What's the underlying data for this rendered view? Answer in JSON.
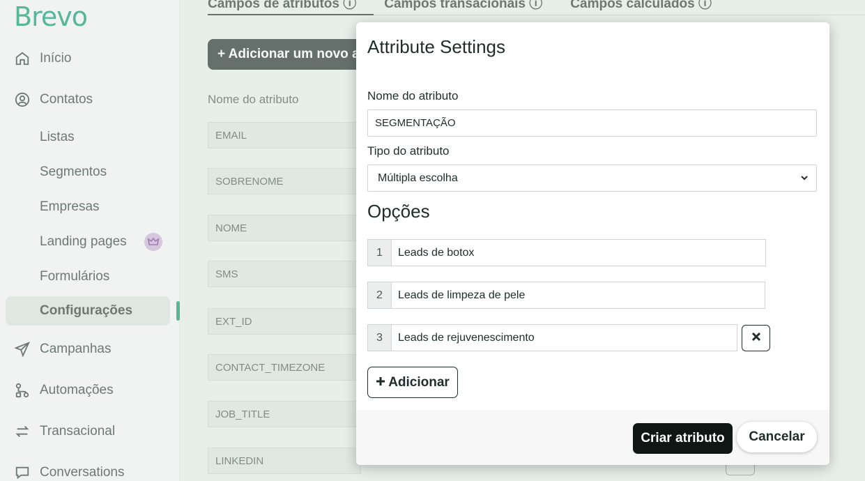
{
  "app": {
    "logo": "Brevo"
  },
  "sidebar": {
    "items": [
      {
        "label": "Início",
        "icon": "home-icon"
      },
      {
        "label": "Contatos",
        "icon": "contacts-icon"
      },
      {
        "label": "Campanhas",
        "icon": "send-icon"
      },
      {
        "label": "Automações",
        "icon": "automation-icon"
      },
      {
        "label": "Transacional",
        "icon": "transactional-icon"
      },
      {
        "label": "Conversations",
        "icon": "chat-icon"
      }
    ],
    "subitems": [
      {
        "label": "Listas"
      },
      {
        "label": "Segmentos"
      },
      {
        "label": "Empresas"
      },
      {
        "label": "Landing pages",
        "badge": "crown-icon"
      },
      {
        "label": "Formulários"
      },
      {
        "label": "Configurações",
        "active": true
      }
    ]
  },
  "main": {
    "tabs": [
      {
        "label": "Campos de atributos ⓘ"
      },
      {
        "label": "Campos transacionais ⓘ"
      },
      {
        "label": "Campos calculados ⓘ"
      }
    ],
    "add_button": "+ Adicionar um novo atributo",
    "column_header": "Nome do atributo",
    "attributes": [
      "EMAIL",
      "SOBRENOME",
      "NOME",
      "SMS",
      "EXT_ID",
      "CONTACT_TIMEZONE",
      "JOB_TITLE",
      "LINKEDIN"
    ]
  },
  "modal": {
    "title": "Attribute Settings",
    "name_label": "Nome do atributo",
    "name_value": "SEGMENTAÇÃO",
    "type_label": "Tipo do atributo",
    "type_value": "Múltipla escolha",
    "options_title": "Opções",
    "options": [
      {
        "num": "1",
        "value": "Leads de botox"
      },
      {
        "num": "2",
        "value": "Leads de limpeza de pele"
      },
      {
        "num": "3",
        "value": "Leads de rejuvenescimento"
      }
    ],
    "add_option": "Adicionar",
    "create_button": "Criar atributo",
    "cancel_button": "Cancelar"
  },
  "colors": {
    "brand": "#0b996e",
    "dark": "#1f2d2a"
  }
}
